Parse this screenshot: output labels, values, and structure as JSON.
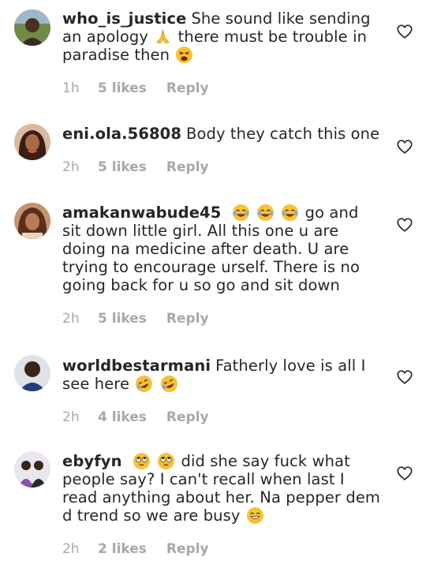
{
  "comments": [
    {
      "username": "who_is_justice",
      "text_parts": [
        "She sound like sending an apology",
        " there must be trouble in paradise then"
      ],
      "emojis": [
        "folded-hands",
        "tired-face"
      ],
      "time": "1h",
      "likes": "5 likes",
      "reply": "Reply"
    },
    {
      "username": "eni.ola.56808",
      "text": "Body they catch this one",
      "time": "2h",
      "likes": "5 likes",
      "reply": "Reply"
    },
    {
      "username": "amakanwabude45",
      "text": " go and sit down little girl. All this one u are doing na medicine after death. U are trying to encourage urself. There is no going back for u so go and sit down",
      "emojis": [
        "face-with-tears-of-joy",
        "face-with-tears-of-joy",
        "face-with-tears-of-joy"
      ],
      "time": "2h",
      "likes": "5 likes",
      "reply": "Reply"
    },
    {
      "username": "worldbestarmani",
      "text": "Fatherly love is all I see here",
      "emojis": [
        "rolling-on-floor-laughing",
        "rolling-on-floor-laughing"
      ],
      "time": "2h",
      "likes": "4 likes",
      "reply": "Reply"
    },
    {
      "username": "ebyfyn",
      "text": " did she say fuck what people say? I can't recall when last I read anything about her. Na pepper dem d trend so we are busy",
      "emojis": [
        "face-with-rolling-eyes",
        "face-with-rolling-eyes",
        "grinning-face-with-smiling-eyes"
      ],
      "time": "2h",
      "likes": "2 likes",
      "reply": "Reply"
    }
  ],
  "colors": {
    "text": "#262626",
    "meta": "#a8a8a8",
    "emoji_yellow": "#f7c234"
  }
}
